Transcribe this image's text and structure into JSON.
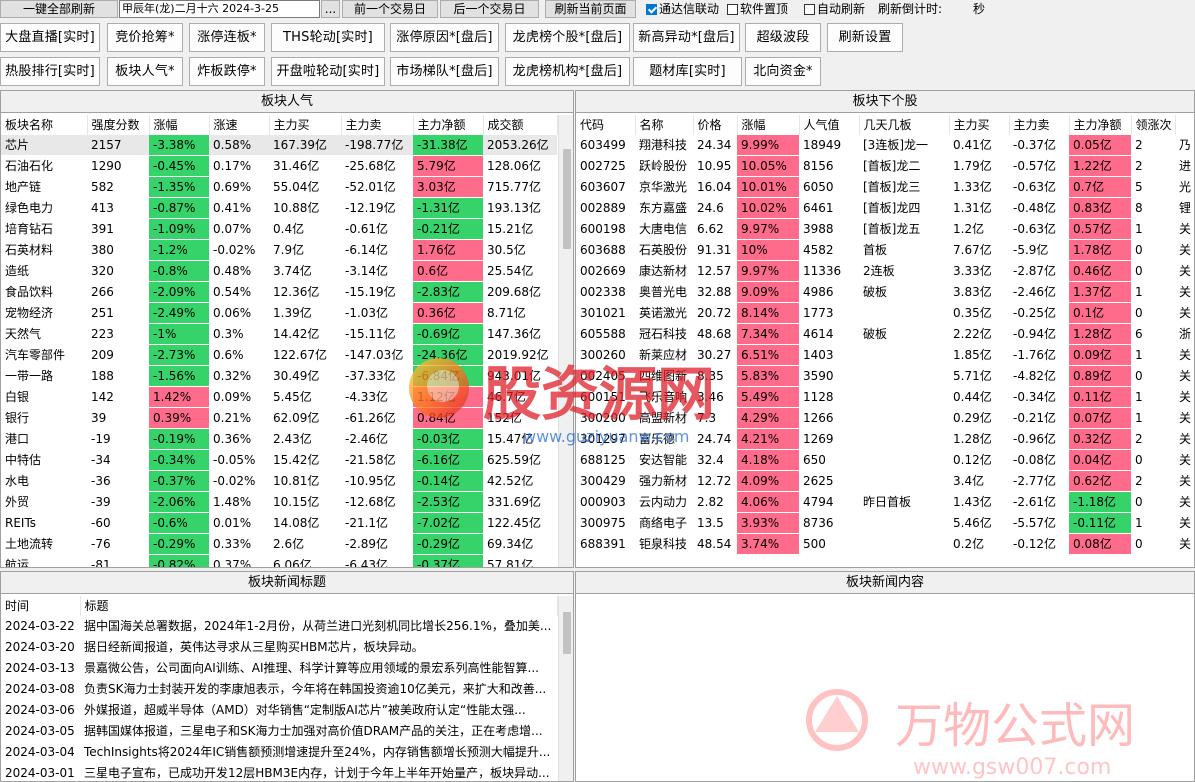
{
  "toolbar": {
    "refresh_all": "一键全部刷新",
    "date_display": "甲辰年(龙)二月十六  2024-3-25",
    "more_btn": "...",
    "prev_day": "前一个交易日",
    "next_day": "后一个交易日",
    "refresh_page": "刷新当前页面",
    "sync_label": "通达信联动",
    "sync_checked": true,
    "pin_label": "软件置顶",
    "pin_checked": false,
    "auto_label": "自动刷新",
    "auto_checked": false,
    "countdown_label": "刷新倒计时:",
    "countdown_unit": "秒"
  },
  "nav_row1": [
    "大盘直播[实时]",
    "竞价抢筹*",
    "涨停连板*",
    "THS轮动[实时]",
    "涨停原因*[盘后]",
    "龙虎榜个股*[盘后]",
    "新高异动*[盘后]",
    "超级波段",
    "刷新设置"
  ],
  "nav_row2": [
    "热股排行[实时]",
    "板块人气*",
    "炸板跌停*",
    "开盘啦轮动[实时]",
    "市场梯队*[盘后]",
    "龙虎榜机构*[盘后]",
    "题材库[实时]",
    "北向资金*"
  ],
  "sector_panel": {
    "title": "板块人气",
    "columns": [
      "板块名称",
      "强度分数",
      "涨幅",
      "涨速",
      "主力买",
      "主力卖",
      "主力净额",
      "成交额"
    ],
    "rows": [
      [
        "芯片",
        "2157",
        "-3.38%",
        "0.58%",
        "167.39亿",
        "-198.77亿",
        "-31.38亿",
        "2053.26亿"
      ],
      [
        "石油石化",
        "1290",
        "-0.45%",
        "0.17%",
        "31.46亿",
        "-25.68亿",
        "5.79亿",
        "128.06亿"
      ],
      [
        "地产链",
        "582",
        "-1.35%",
        "0.69%",
        "55.04亿",
        "-52.01亿",
        "3.03亿",
        "715.77亿"
      ],
      [
        "绿色电力",
        "413",
        "-0.87%",
        "0.41%",
        "10.88亿",
        "-12.19亿",
        "-1.31亿",
        "193.13亿"
      ],
      [
        "培育钻石",
        "391",
        "-1.09%",
        "0.07%",
        "0.4亿",
        "-0.61亿",
        "-0.21亿",
        "15.21亿"
      ],
      [
        "石英材料",
        "380",
        "-1.2%",
        "-0.02%",
        "7.9亿",
        "-6.14亿",
        "1.76亿",
        "30.5亿"
      ],
      [
        "造纸",
        "320",
        "-0.8%",
        "0.48%",
        "3.74亿",
        "-3.14亿",
        "0.6亿",
        "25.54亿"
      ],
      [
        "食品饮料",
        "266",
        "-2.09%",
        "0.54%",
        "12.36亿",
        "-15.19亿",
        "-2.83亿",
        "209.68亿"
      ],
      [
        "宠物经济",
        "251",
        "-2.49%",
        "0.06%",
        "1.39亿",
        "-1.03亿",
        "0.36亿",
        "8.71亿"
      ],
      [
        "天然气",
        "223",
        "-1%",
        "0.3%",
        "14.42亿",
        "-15.11亿",
        "-0.69亿",
        "147.36亿"
      ],
      [
        "汽车零部件",
        "209",
        "-2.73%",
        "0.6%",
        "122.67亿",
        "-147.03亿",
        "-24.36亿",
        "2019.92亿"
      ],
      [
        "一带一路",
        "188",
        "-1.56%",
        "0.32%",
        "30.49亿",
        "-37.33亿",
        "-6.84亿",
        "943.01亿"
      ],
      [
        "白银",
        "142",
        "1.42%",
        "0.09%",
        "5.45亿",
        "-4.33亿",
        "1.12亿",
        "46.7亿"
      ],
      [
        "银行",
        "39",
        "0.39%",
        "0.21%",
        "62.09亿",
        "-61.26亿",
        "0.84亿",
        "152亿"
      ],
      [
        "港口",
        "-19",
        "-0.19%",
        "0.36%",
        "2.43亿",
        "-2.46亿",
        "-0.03亿",
        "15.47亿"
      ],
      [
        "中特估",
        "-34",
        "-0.34%",
        "-0.05%",
        "15.42亿",
        "-21.58亿",
        "-6.16亿",
        "625.59亿"
      ],
      [
        "水电",
        "-36",
        "-0.37%",
        "-0.02%",
        "10.81亿",
        "-10.95亿",
        "-0.14亿",
        "42.52亿"
      ],
      [
        "外贸",
        "-39",
        "-2.06%",
        "1.48%",
        "10.15亿",
        "-12.68亿",
        "-2.53亿",
        "331.69亿"
      ],
      [
        "REITs",
        "-60",
        "-0.6%",
        "0.01%",
        "14.08亿",
        "-21.1亿",
        "-7.02亿",
        "122.45亿"
      ],
      [
        "土地流转",
        "-76",
        "-0.29%",
        "0.33%",
        "2.6亿",
        "-2.89亿",
        "-0.29亿",
        "69.34亿"
      ],
      [
        "航运",
        "-81",
        "-0.82%",
        "0.37%",
        "6.06亿",
        "-6.43亿",
        "-0.37亿",
        "57.81亿"
      ]
    ]
  },
  "stock_panel": {
    "title": "板块下个股",
    "columns": [
      "代码",
      "名称",
      "价格",
      "涨幅",
      "人气值",
      "几天几板",
      "主力买",
      "主力卖",
      "主力净额",
      "领涨次",
      ""
    ],
    "rows": [
      [
        "603499",
        "翔港科技",
        "24.34",
        "9.99%",
        "18949",
        "[3连板]龙一",
        "0.41亿",
        "-0.37亿",
        "0.05亿",
        "2",
        "乃"
      ],
      [
        "002725",
        "跃岭股份",
        "10.95",
        "10.05%",
        "8156",
        "[首板]龙二",
        "1.79亿",
        "-0.57亿",
        "1.22亿",
        "2",
        "进"
      ],
      [
        "603607",
        "京华激光",
        "16.04",
        "10.01%",
        "6050",
        "[首板]龙三",
        "1.33亿",
        "-0.63亿",
        "0.7亿",
        "5",
        "光"
      ],
      [
        "002889",
        "东方嘉盛",
        "24.6",
        "10.02%",
        "6461",
        "[首板]龙四",
        "1.31亿",
        "-0.48亿",
        "0.83亿",
        "8",
        "锂"
      ],
      [
        "600198",
        "大唐电信",
        "6.62",
        "9.97%",
        "3988",
        "[首板]龙五",
        "1.2亿",
        "-0.63亿",
        "0.57亿",
        "1",
        "关"
      ],
      [
        "603688",
        "石英股份",
        "91.31",
        "10%",
        "4582",
        "首板",
        "7.67亿",
        "-5.9亿",
        "1.78亿",
        "0",
        "关"
      ],
      [
        "002669",
        "康达新材",
        "12.57",
        "9.97%",
        "11336",
        "2连板",
        "3.33亿",
        "-2.87亿",
        "0.46亿",
        "0",
        "关"
      ],
      [
        "002338",
        "奥普光电",
        "32.88",
        "9.09%",
        "4986",
        "破板",
        "3.83亿",
        "-2.46亿",
        "1.37亿",
        "1",
        "关"
      ],
      [
        "301021",
        "英诺激光",
        "20.72",
        "8.14%",
        "1773",
        "",
        "0.35亿",
        "-0.25亿",
        "0.1亿",
        "0",
        "关"
      ],
      [
        "605588",
        "冠石科技",
        "48.68",
        "7.34%",
        "4614",
        "破板",
        "2.22亿",
        "-0.94亿",
        "1.28亿",
        "6",
        "浙"
      ],
      [
        "300260",
        "新莱应材",
        "30.27",
        "6.51%",
        "1403",
        "",
        "1.85亿",
        "-1.76亿",
        "0.09亿",
        "1",
        "关"
      ],
      [
        "002405",
        "四维图新",
        "8.35",
        "5.83%",
        "3590",
        "",
        "5.71亿",
        "-4.82亿",
        "0.89亿",
        "0",
        "关"
      ],
      [
        "600151",
        "飞乐音响",
        "3.46",
        "5.49%",
        "1128",
        "",
        "0.44亿",
        "-0.34亿",
        "0.11亿",
        "1",
        "关"
      ],
      [
        "300200",
        "高盟新材",
        "7.3",
        "4.29%",
        "1266",
        "",
        "0.29亿",
        "-0.21亿",
        "0.07亿",
        "1",
        "关"
      ],
      [
        "301297",
        "富乐德",
        "24.74",
        "4.21%",
        "1269",
        "",
        "1.28亿",
        "-0.96亿",
        "0.32亿",
        "2",
        "关"
      ],
      [
        "688125",
        "安达智能",
        "32.4",
        "4.18%",
        "650",
        "",
        "0.12亿",
        "-0.08亿",
        "0.04亿",
        "0",
        "关"
      ],
      [
        "300429",
        "强力新材",
        "12.72",
        "4.09%",
        "2625",
        "",
        "3.4亿",
        "-2.77亿",
        "0.62亿",
        "2",
        "关"
      ],
      [
        "000903",
        "云内动力",
        "2.82",
        "4.06%",
        "4794",
        "昨日首板",
        "1.43亿",
        "-2.61亿",
        "-1.18亿",
        "0",
        "关"
      ],
      [
        "300975",
        "商络电子",
        "13.5",
        "3.93%",
        "8736",
        "",
        "5.46亿",
        "-5.57亿",
        "-0.11亿",
        "1",
        "关"
      ],
      [
        "688391",
        "钜泉科技",
        "48.54",
        "3.74%",
        "500",
        "",
        "0.2亿",
        "-0.12亿",
        "0.08亿",
        "0",
        "关"
      ]
    ]
  },
  "news_panel": {
    "title": "板块新闻标题",
    "columns": [
      "时间",
      "标题"
    ],
    "rows": [
      [
        "2024-03-22",
        "据中国海关总署数据，2024年1-2月份，从荷兰进口光刻机同比增长256.1%，叠加美..."
      ],
      [
        "2024-03-20",
        "据日经新闻报道，英伟达寻求从三星购买HBM芯片，板块异动。"
      ],
      [
        "2024-03-13",
        "景嘉微公告，公司面向AI训练、AI推理、科学计算等应用领域的景宏系列高性能智算..."
      ],
      [
        "2024-03-08",
        "负责SK海力士封装开发的李康旭表示，今年将在韩国投资逾10亿美元，来扩大和改善..."
      ],
      [
        "2024-03-06",
        "外媒报道，超威半导体（AMD）对华销售“定制版AI芯片”被美政府认定“性能太强..."
      ],
      [
        "2024-03-05",
        "据韩国媒体报道，三星电子和SK海力士加强对高价值DRAM产品的关注，正在考虑增..."
      ],
      [
        "2024-03-04",
        "TechInsights将2024年IC销售额预测增速提升至24%，内存销售额增长预测大幅提升..."
      ],
      [
        "2024-03-01",
        "三星电子宣布，已成功开发12层HBM3E内存，计划于今年上半年开始量产，板块异动..."
      ]
    ]
  },
  "content_panel": {
    "title": "板块新闻内容"
  },
  "watermarks": {
    "wm1_text": "股资源网",
    "wm1_url": "www.guziyuanw.com",
    "wm2_text": "万物公式网",
    "wm2_url": "www.gsw007.com"
  },
  "colors": {
    "up": "#ff6b8b",
    "down": "#35d36a",
    "selected_row": "#e8e8e8",
    "check_accent": "#0078d7"
  }
}
